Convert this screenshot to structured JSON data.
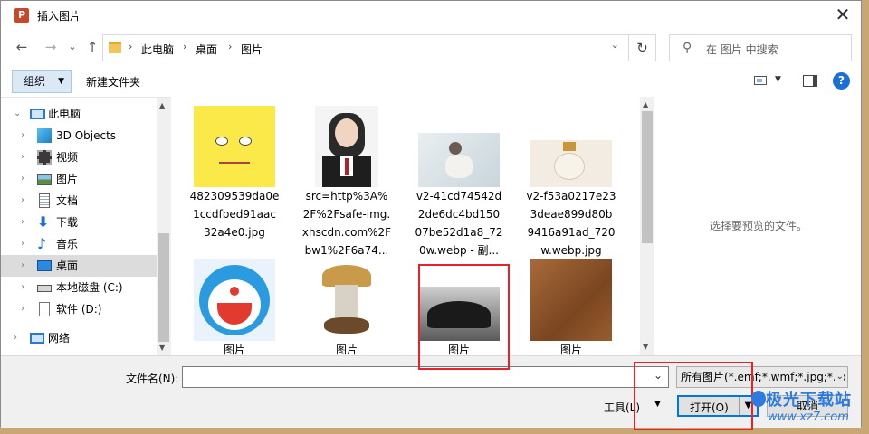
{
  "window": {
    "title": "插入图片",
    "app_icon_letter": "P"
  },
  "nav": {
    "back": "←",
    "forward": "→",
    "recent": "⌄",
    "up": "↑",
    "breadcrumb": [
      "此电脑",
      "桌面",
      "图片"
    ],
    "search_placeholder": "在 图片 中搜索"
  },
  "toolbar": {
    "organize": "组织",
    "new_folder": "新建文件夹"
  },
  "sidebar": {
    "items": [
      {
        "label": "此电脑",
        "icon": "computer-icon",
        "expanded": true
      },
      {
        "label": "3D Objects",
        "icon": "cube-3d-icon"
      },
      {
        "label": "视频",
        "icon": "video-icon"
      },
      {
        "label": "图片",
        "icon": "picture-icon"
      },
      {
        "label": "文档",
        "icon": "document-icon"
      },
      {
        "label": "下载",
        "icon": "download-icon"
      },
      {
        "label": "音乐",
        "icon": "music-icon"
      },
      {
        "label": "桌面",
        "icon": "desktop-icon",
        "selected": true
      },
      {
        "label": "本地磁盘 (C:)",
        "icon": "drive-icon"
      },
      {
        "label": "软件 (D:)",
        "icon": "drive-icon"
      },
      {
        "label": "网络",
        "icon": "network-icon"
      }
    ]
  },
  "files": [
    {
      "name": "482309539da0e1ccdfbed91aac32a4e0.jpg",
      "lines": [
        "482309539da0e",
        "1ccdfbed91aac",
        "32a4e0.jpg"
      ]
    },
    {
      "name": "src=http%3A%2F%2Fsafe-img.xhscdn.com%2Fbw1%2F6a74...",
      "lines": [
        "src=http%3A%",
        "2F%2Fsafe-img.",
        "xhscdn.com%2F",
        "bw1%2F6a74..."
      ]
    },
    {
      "name": "v2-41cd74542d2de6dc4bd15007be52d1a8_720w.webp - 副...",
      "lines": [
        "v2-41cd74542d",
        "2de6dc4bd150",
        "07be52d1a8_72",
        "0w.webp - 副..."
      ]
    },
    {
      "name": "v2-f53a0217e233deae899d80b9416a91ad_720w.webp.jpg",
      "lines": [
        "v2-f53a0217e23",
        "3deae899d80b",
        "9416a91ad_720",
        "w.webp.jpg"
      ]
    },
    {
      "name": "图片",
      "lines": [
        "图片"
      ]
    },
    {
      "name": "图片",
      "lines": [
        "图片"
      ]
    },
    {
      "name": "图片",
      "lines": [
        "图片"
      ]
    },
    {
      "name": "图片",
      "lines": [
        "图片"
      ]
    }
  ],
  "preview": {
    "text": "选择要预览的文件。"
  },
  "bottom": {
    "filename_label": "文件名(N):",
    "filename_value": "",
    "filetype": "所有图片(*.emf;*.wmf;*.jpg;*.jp",
    "tools": "工具(L)",
    "open": "打开(O)",
    "cancel": "取消"
  },
  "watermark": {
    "name": "极光下载站",
    "url": "www.xz7.com"
  },
  "colors": {
    "accent": "#0078d7",
    "highlight_box": "#e8222a",
    "selected_row": "#dcdcdc",
    "organize_bg": "#dbe9f6"
  }
}
